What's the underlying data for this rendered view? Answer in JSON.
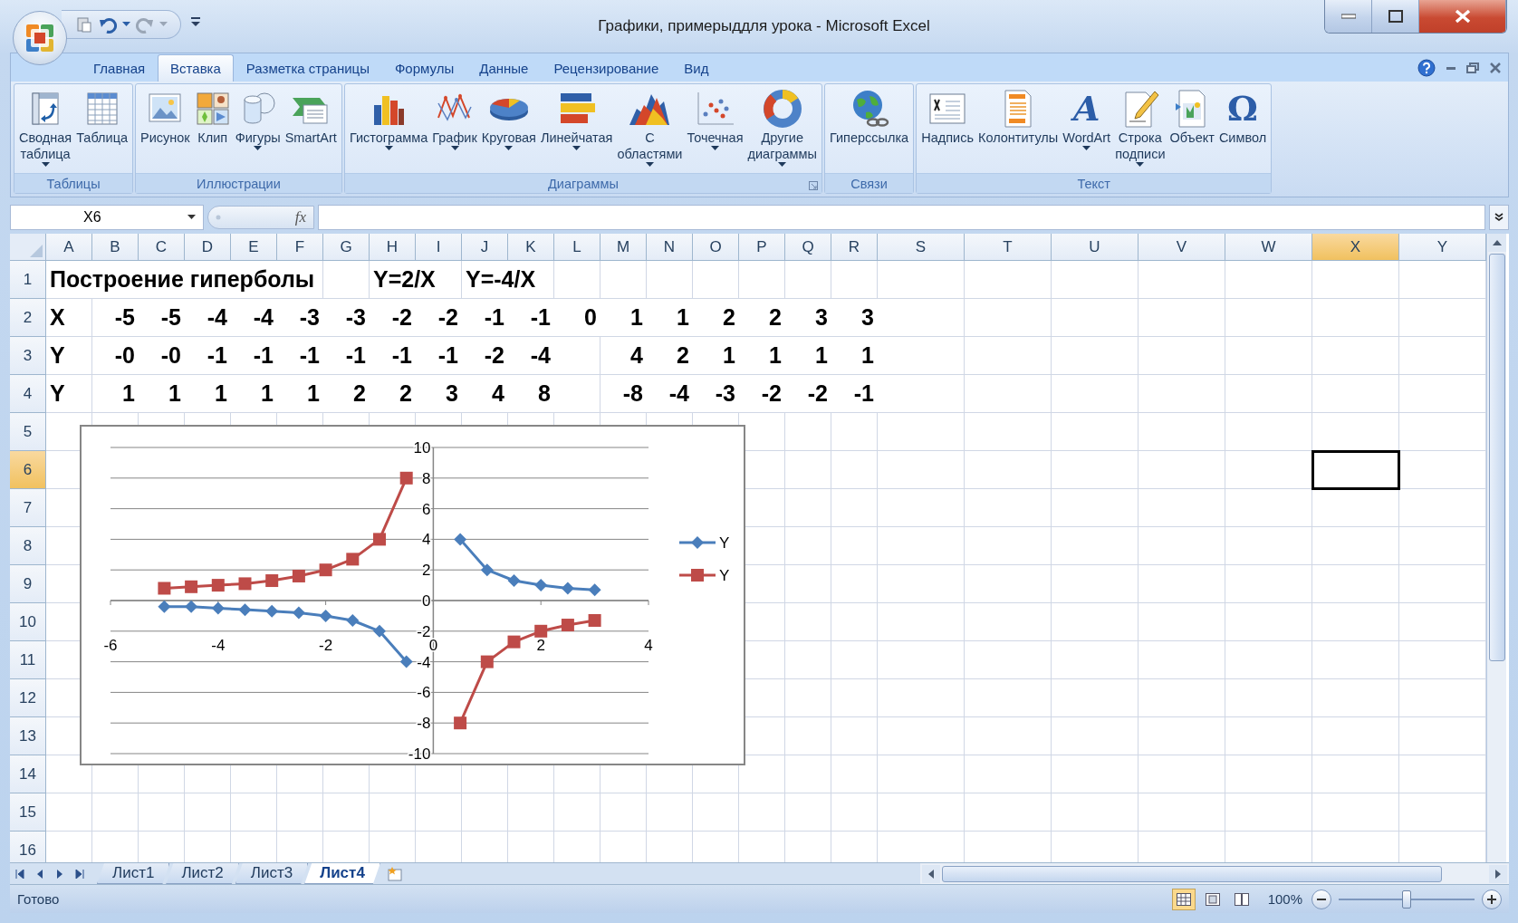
{
  "window": {
    "title": "Графики, примерыддля урока - Microsoft Excel"
  },
  "ribbon_tabs": [
    {
      "label": "Главная",
      "selected": false
    },
    {
      "label": "Вставка",
      "selected": true
    },
    {
      "label": "Разметка страницы",
      "selected": false
    },
    {
      "label": "Формулы",
      "selected": false
    },
    {
      "label": "Данные",
      "selected": false
    },
    {
      "label": "Рецензирование",
      "selected": false
    },
    {
      "label": "Вид",
      "selected": false
    }
  ],
  "ribbon_groups": [
    {
      "label": "Таблицы",
      "launcher": false,
      "buttons": [
        {
          "label": "Сводная\nтаблица",
          "dropdown": true
        },
        {
          "label": "Таблица",
          "dropdown": false
        }
      ]
    },
    {
      "label": "Иллюстрации",
      "launcher": false,
      "buttons": [
        {
          "label": "Рисунок",
          "dropdown": false
        },
        {
          "label": "Клип",
          "dropdown": false
        },
        {
          "label": "Фигуры",
          "dropdown": true
        },
        {
          "label": "SmartArt",
          "dropdown": false
        }
      ]
    },
    {
      "label": "Диаграммы",
      "launcher": true,
      "buttons": [
        {
          "label": "Гистограмма",
          "dropdown": true
        },
        {
          "label": "График",
          "dropdown": true
        },
        {
          "label": "Круговая",
          "dropdown": true
        },
        {
          "label": "Линейчатая",
          "dropdown": true
        },
        {
          "label": "С\nобластями",
          "dropdown": true
        },
        {
          "label": "Точечная",
          "dropdown": true
        },
        {
          "label": "Другие\nдиаграммы",
          "dropdown": true
        }
      ]
    },
    {
      "label": "Связи",
      "launcher": false,
      "buttons": [
        {
          "label": "Гиперссылка",
          "dropdown": false
        }
      ]
    },
    {
      "label": "Текст",
      "launcher": false,
      "buttons": [
        {
          "label": "Надпись",
          "dropdown": false
        },
        {
          "label": "Колонтитулы",
          "dropdown": false
        },
        {
          "label": "WordArt",
          "dropdown": true,
          "glyph": "A"
        },
        {
          "label": "Строка\nподписи",
          "dropdown": true
        },
        {
          "label": "Объект",
          "dropdown": false
        },
        {
          "label": "Символ",
          "dropdown": false,
          "glyph": "Ω"
        }
      ]
    }
  ],
  "formula_bar": {
    "name_box": "X6",
    "function_label": "fx"
  },
  "columns": [
    {
      "label": "A",
      "selected": false
    },
    {
      "label": "B",
      "selected": false
    },
    {
      "label": "C",
      "selected": false
    },
    {
      "label": "D",
      "selected": false
    },
    {
      "label": "E",
      "selected": false
    },
    {
      "label": "F",
      "selected": false
    },
    {
      "label": "G",
      "selected": false
    },
    {
      "label": "H",
      "selected": false
    },
    {
      "label": "I",
      "selected": false
    },
    {
      "label": "J",
      "selected": false
    },
    {
      "label": "K",
      "selected": false
    },
    {
      "label": "L",
      "selected": false
    },
    {
      "label": "M",
      "selected": false
    },
    {
      "label": "N",
      "selected": false
    },
    {
      "label": "O",
      "selected": false
    },
    {
      "label": "P",
      "selected": false
    },
    {
      "label": "Q",
      "selected": false
    },
    {
      "label": "R",
      "selected": false
    },
    {
      "label": "S",
      "selected": false
    },
    {
      "label": "T",
      "selected": false
    },
    {
      "label": "U",
      "selected": false
    },
    {
      "label": "V",
      "selected": false
    },
    {
      "label": "W",
      "selected": false
    },
    {
      "label": "X",
      "selected": true
    },
    {
      "label": "Y",
      "selected": false
    }
  ],
  "rows": [
    {
      "number": "1",
      "selected": false,
      "kind": "title",
      "cells": [
        "Построение гиперболы",
        null,
        null,
        null,
        null,
        null,
        null,
        "Y=2/X",
        null,
        "Y=-4/X"
      ]
    },
    {
      "number": "2",
      "selected": false,
      "kind": "values",
      "cells": [
        "X",
        "-5",
        "-5",
        "-4",
        "-4",
        "-3",
        "-3",
        "-2",
        "-2",
        "-1",
        "-1",
        "0",
        "1",
        "1",
        "2",
        "2",
        "3",
        "3"
      ]
    },
    {
      "number": "3",
      "selected": false,
      "kind": "values",
      "cells": [
        "Y",
        "-0",
        "-0",
        "-1",
        "-1",
        "-1",
        "-1",
        "-1",
        "-1",
        "-2",
        "-4",
        null,
        "4",
        "2",
        "1",
        "1",
        "1",
        "1"
      ]
    },
    {
      "number": "4",
      "selected": false,
      "kind": "values",
      "cells": [
        "Y",
        "1",
        "1",
        "1",
        "1",
        "1",
        "2",
        "2",
        "3",
        "4",
        "8",
        null,
        "-8",
        "-4",
        "-3",
        "-2",
        "-2",
        "-1"
      ]
    },
    {
      "number": "5",
      "selected": false
    },
    {
      "number": "6",
      "selected": true
    },
    {
      "number": "7",
      "selected": false
    },
    {
      "number": "8",
      "selected": false
    },
    {
      "number": "9",
      "selected": false
    },
    {
      "number": "10",
      "selected": false
    },
    {
      "number": "11",
      "selected": false
    },
    {
      "number": "12",
      "selected": false
    },
    {
      "number": "13",
      "selected": false
    },
    {
      "number": "14",
      "selected": false
    },
    {
      "number": "15",
      "selected": false
    },
    {
      "number": "16",
      "selected": false
    }
  ],
  "chart": {
    "chart_data": {
      "type": "line",
      "x": [
        -5,
        -4.5,
        -4,
        -3.5,
        -3,
        -2.5,
        -2,
        -1.5,
        -1,
        -0.5,
        0,
        0.5,
        1,
        1.5,
        2,
        2.5,
        3
      ],
      "series": [
        {
          "name": "Y",
          "color": "#4a7ebb",
          "marker": "diamond",
          "values": [
            -0.4,
            -0.4,
            -0.5,
            -0.6,
            -0.7,
            -0.8,
            -1,
            -1.3,
            -2,
            -4,
            null,
            4,
            2,
            1.3,
            1,
            0.8,
            0.7
          ]
        },
        {
          "name": "Y",
          "color": "#be4b48",
          "marker": "square",
          "values": [
            0.8,
            0.9,
            1,
            1.1,
            1.3,
            1.6,
            2,
            2.7,
            4,
            8,
            null,
            -8,
            -4,
            -2.7,
            -2,
            -1.6,
            -1.3
          ]
        }
      ],
      "grid": true,
      "xlim": [
        -6,
        4
      ],
      "ylim": [
        -10,
        10
      ],
      "xticks": [
        -6,
        -4,
        -2,
        0,
        2,
        4
      ],
      "yticks": [
        -10,
        -8,
        -6,
        -4,
        -2,
        0,
        2,
        4,
        6,
        8,
        10
      ]
    }
  },
  "sheet_tabs": [
    {
      "label": "Лист1",
      "selected": false
    },
    {
      "label": "Лист2",
      "selected": false
    },
    {
      "label": "Лист3",
      "selected": false
    },
    {
      "label": "Лист4",
      "selected": true
    }
  ],
  "status_bar": {
    "status": "Готово",
    "view_buttons": [
      {
        "selected": true
      },
      {
        "selected": false
      },
      {
        "selected": false
      }
    ],
    "zoom": "100%",
    "zoom_level": {
      "level": 0.5
    }
  }
}
